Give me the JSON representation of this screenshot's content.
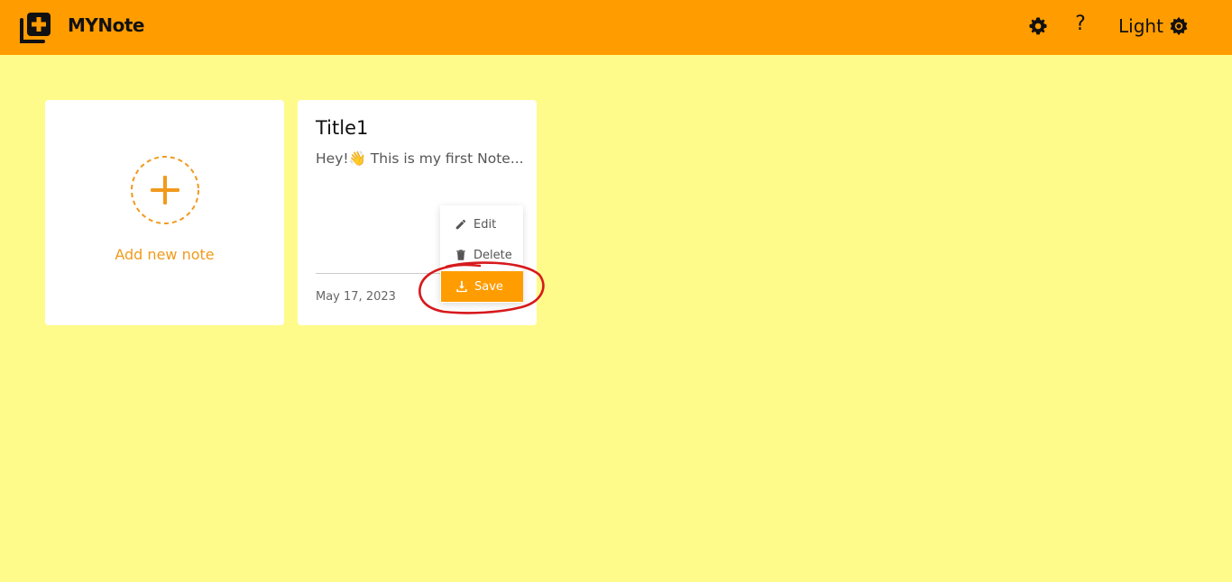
{
  "header": {
    "app_title": "MYNote",
    "logo_icon": "note-add-icon",
    "settings_icon": "gear-icon",
    "help_label": "?",
    "theme_label": "Light",
    "theme_icon": "sun-gear-icon"
  },
  "add_card": {
    "label": "Add new note",
    "icon": "plus-circle-icon"
  },
  "note": {
    "title": "Title1",
    "preview": "Hey!👋 This is my first Note...",
    "date": "May 17, 2023"
  },
  "context_menu": {
    "items": [
      {
        "label": "Edit",
        "icon": "pencil-icon"
      },
      {
        "label": "Delete",
        "icon": "trash-icon"
      },
      {
        "label": "Save",
        "icon": "download-icon"
      }
    ]
  },
  "colors": {
    "header_bg": "#ff9c00",
    "page_bg": "#fffb8b",
    "accent": "#f19a1c",
    "annotation": "#d7191c"
  }
}
